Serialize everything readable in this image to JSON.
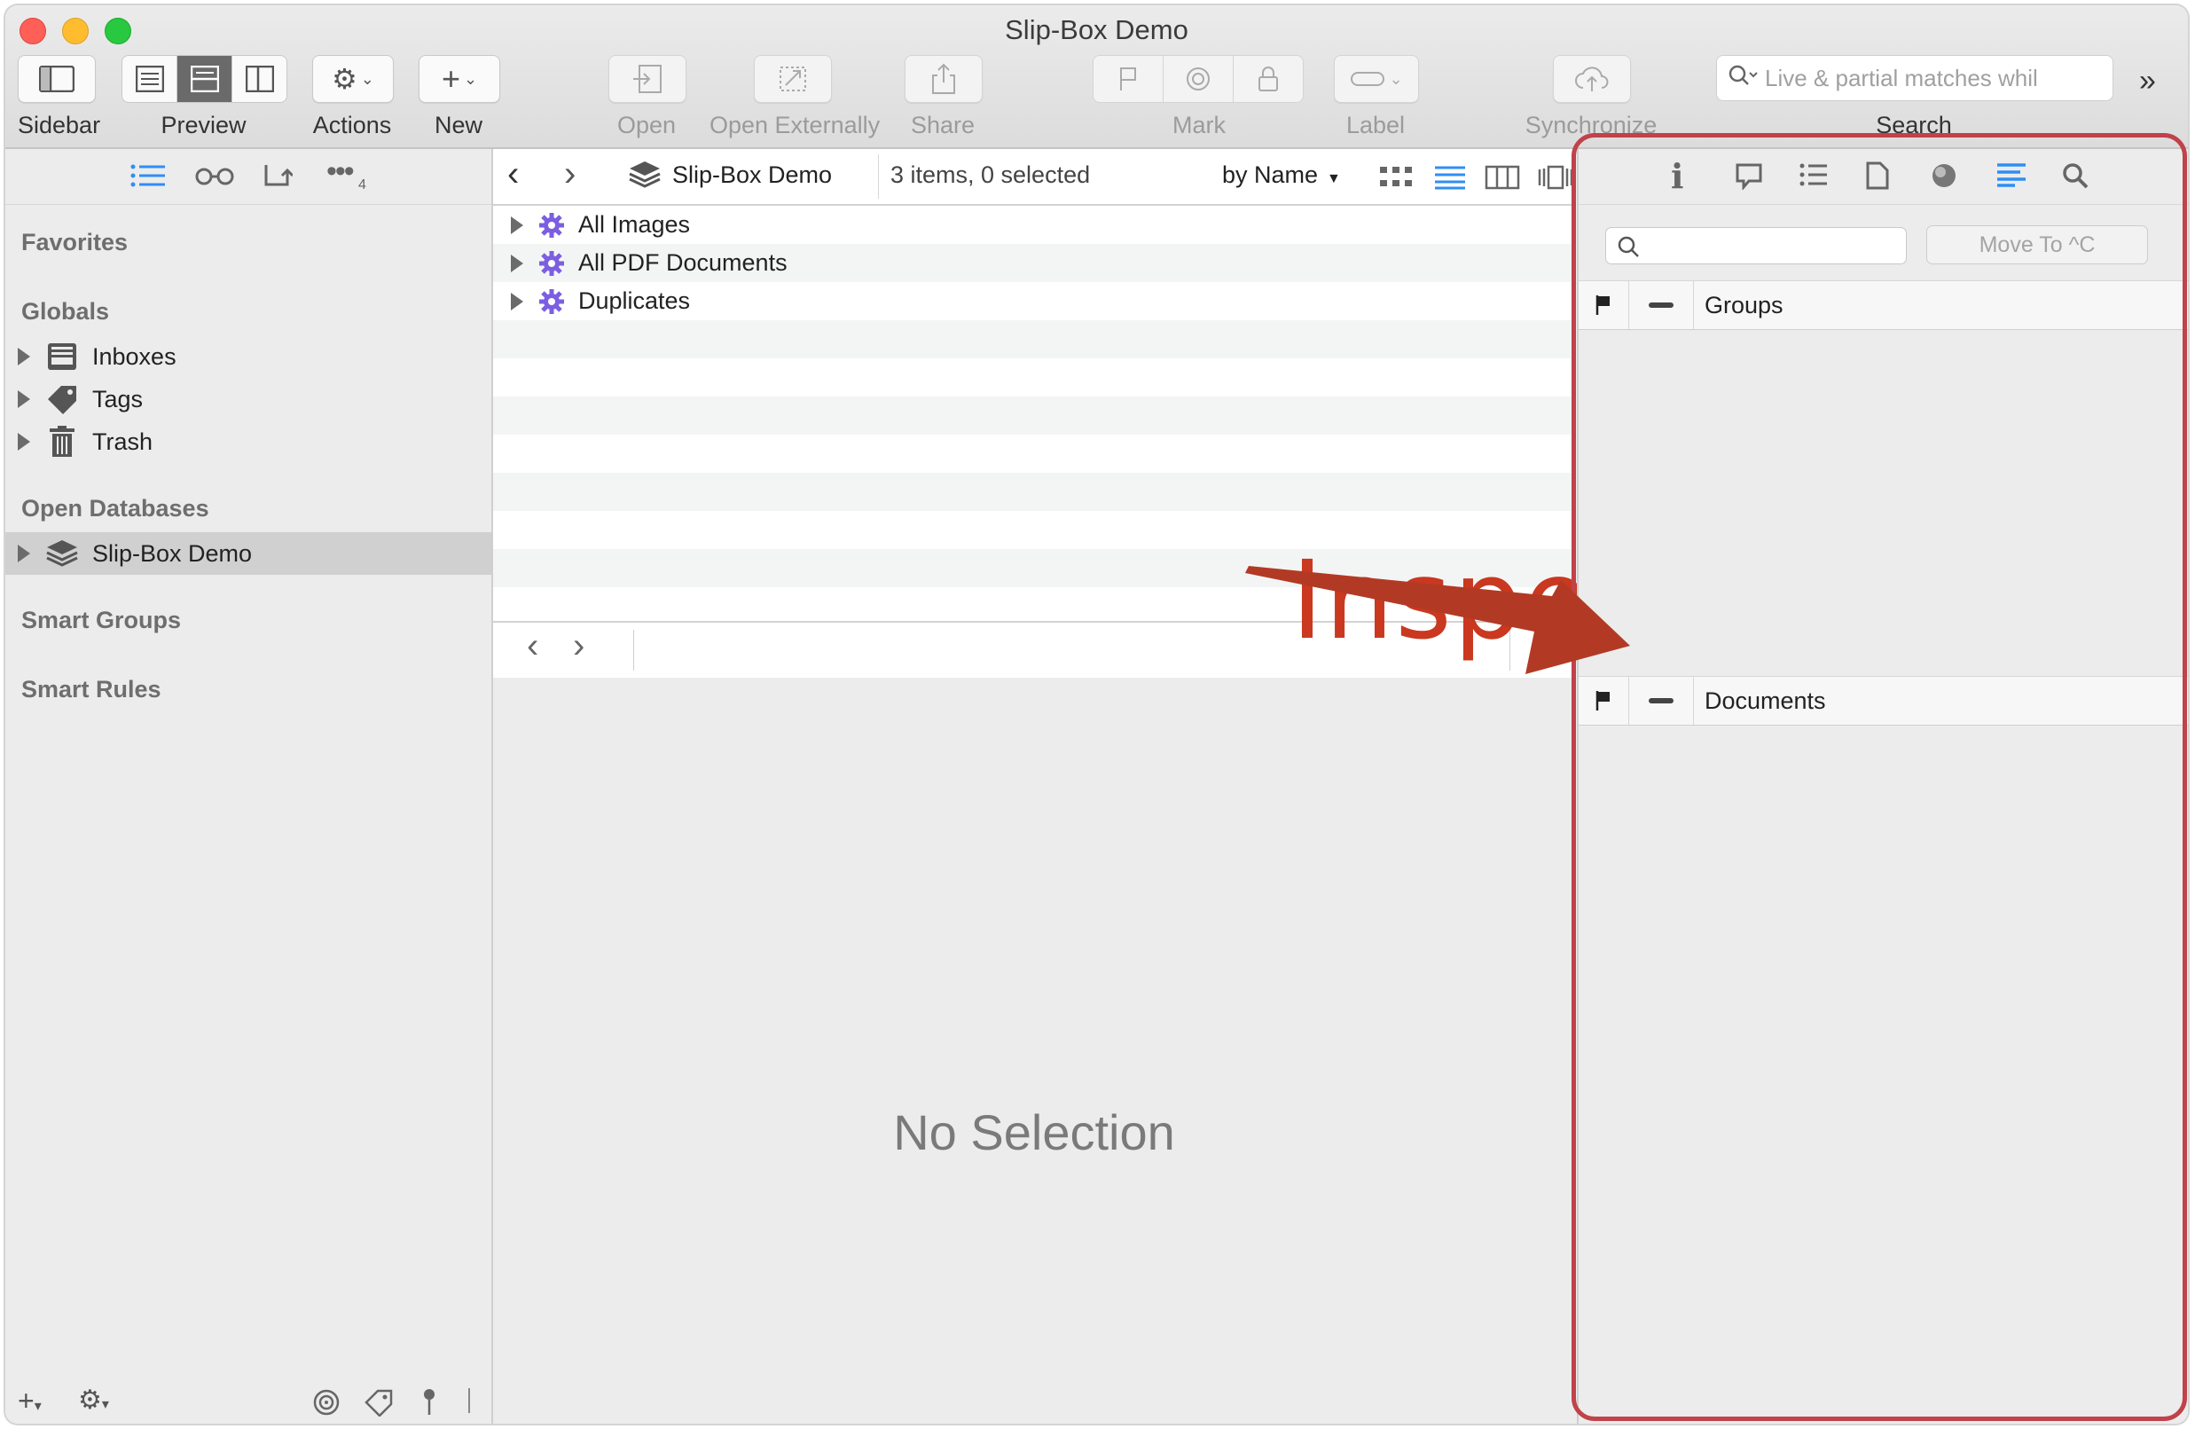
{
  "window": {
    "title": "Slip-Box Demo"
  },
  "toolbar": {
    "sidebar_label": "Sidebar",
    "preview_label": "Preview",
    "actions_label": "Actions",
    "new_label": "New",
    "open_label": "Open",
    "open_externally_label": "Open Externally",
    "share_label": "Share",
    "mark_label": "Mark",
    "label_label": "Label",
    "synchronize_label": "Synchronize",
    "search_label": "Search",
    "search_placeholder": "Live & partial matches whil"
  },
  "sidebar": {
    "more_badge": "4",
    "sections": {
      "favorites": "Favorites",
      "globals": "Globals",
      "open_databases": "Open Databases",
      "smart_groups": "Smart Groups",
      "smart_rules": "Smart Rules"
    },
    "globals_items": [
      {
        "label": "Inboxes",
        "icon": "inbox-icon"
      },
      {
        "label": "Tags",
        "icon": "tag-icon"
      },
      {
        "label": "Trash",
        "icon": "trash-icon"
      }
    ],
    "database": {
      "label": "Slip-Box Demo",
      "icon": "database-stack-icon",
      "selected": true
    }
  },
  "browser": {
    "breadcrumb": "Slip-Box Demo",
    "status": "3 items, 0 selected",
    "sort": "by Name",
    "rows": [
      {
        "label": "All Images",
        "icon": "smart-group-gear-icon"
      },
      {
        "label": "All PDF Documents",
        "icon": "smart-group-gear-icon"
      },
      {
        "label": "Duplicates",
        "icon": "smart-group-gear-icon"
      }
    ],
    "no_selection": "No Selection"
  },
  "annotation": {
    "text": "Inspector",
    "color": "#c9381f",
    "box_color": "#c0424a"
  },
  "inspector": {
    "move_to_label": "Move To ^C",
    "groups_header": "Groups",
    "documents_header": "Documents"
  },
  "colors": {
    "accent": "#2f8ef4",
    "selection": "#d0d0d0",
    "gear_purple": "#7c5fe0"
  }
}
